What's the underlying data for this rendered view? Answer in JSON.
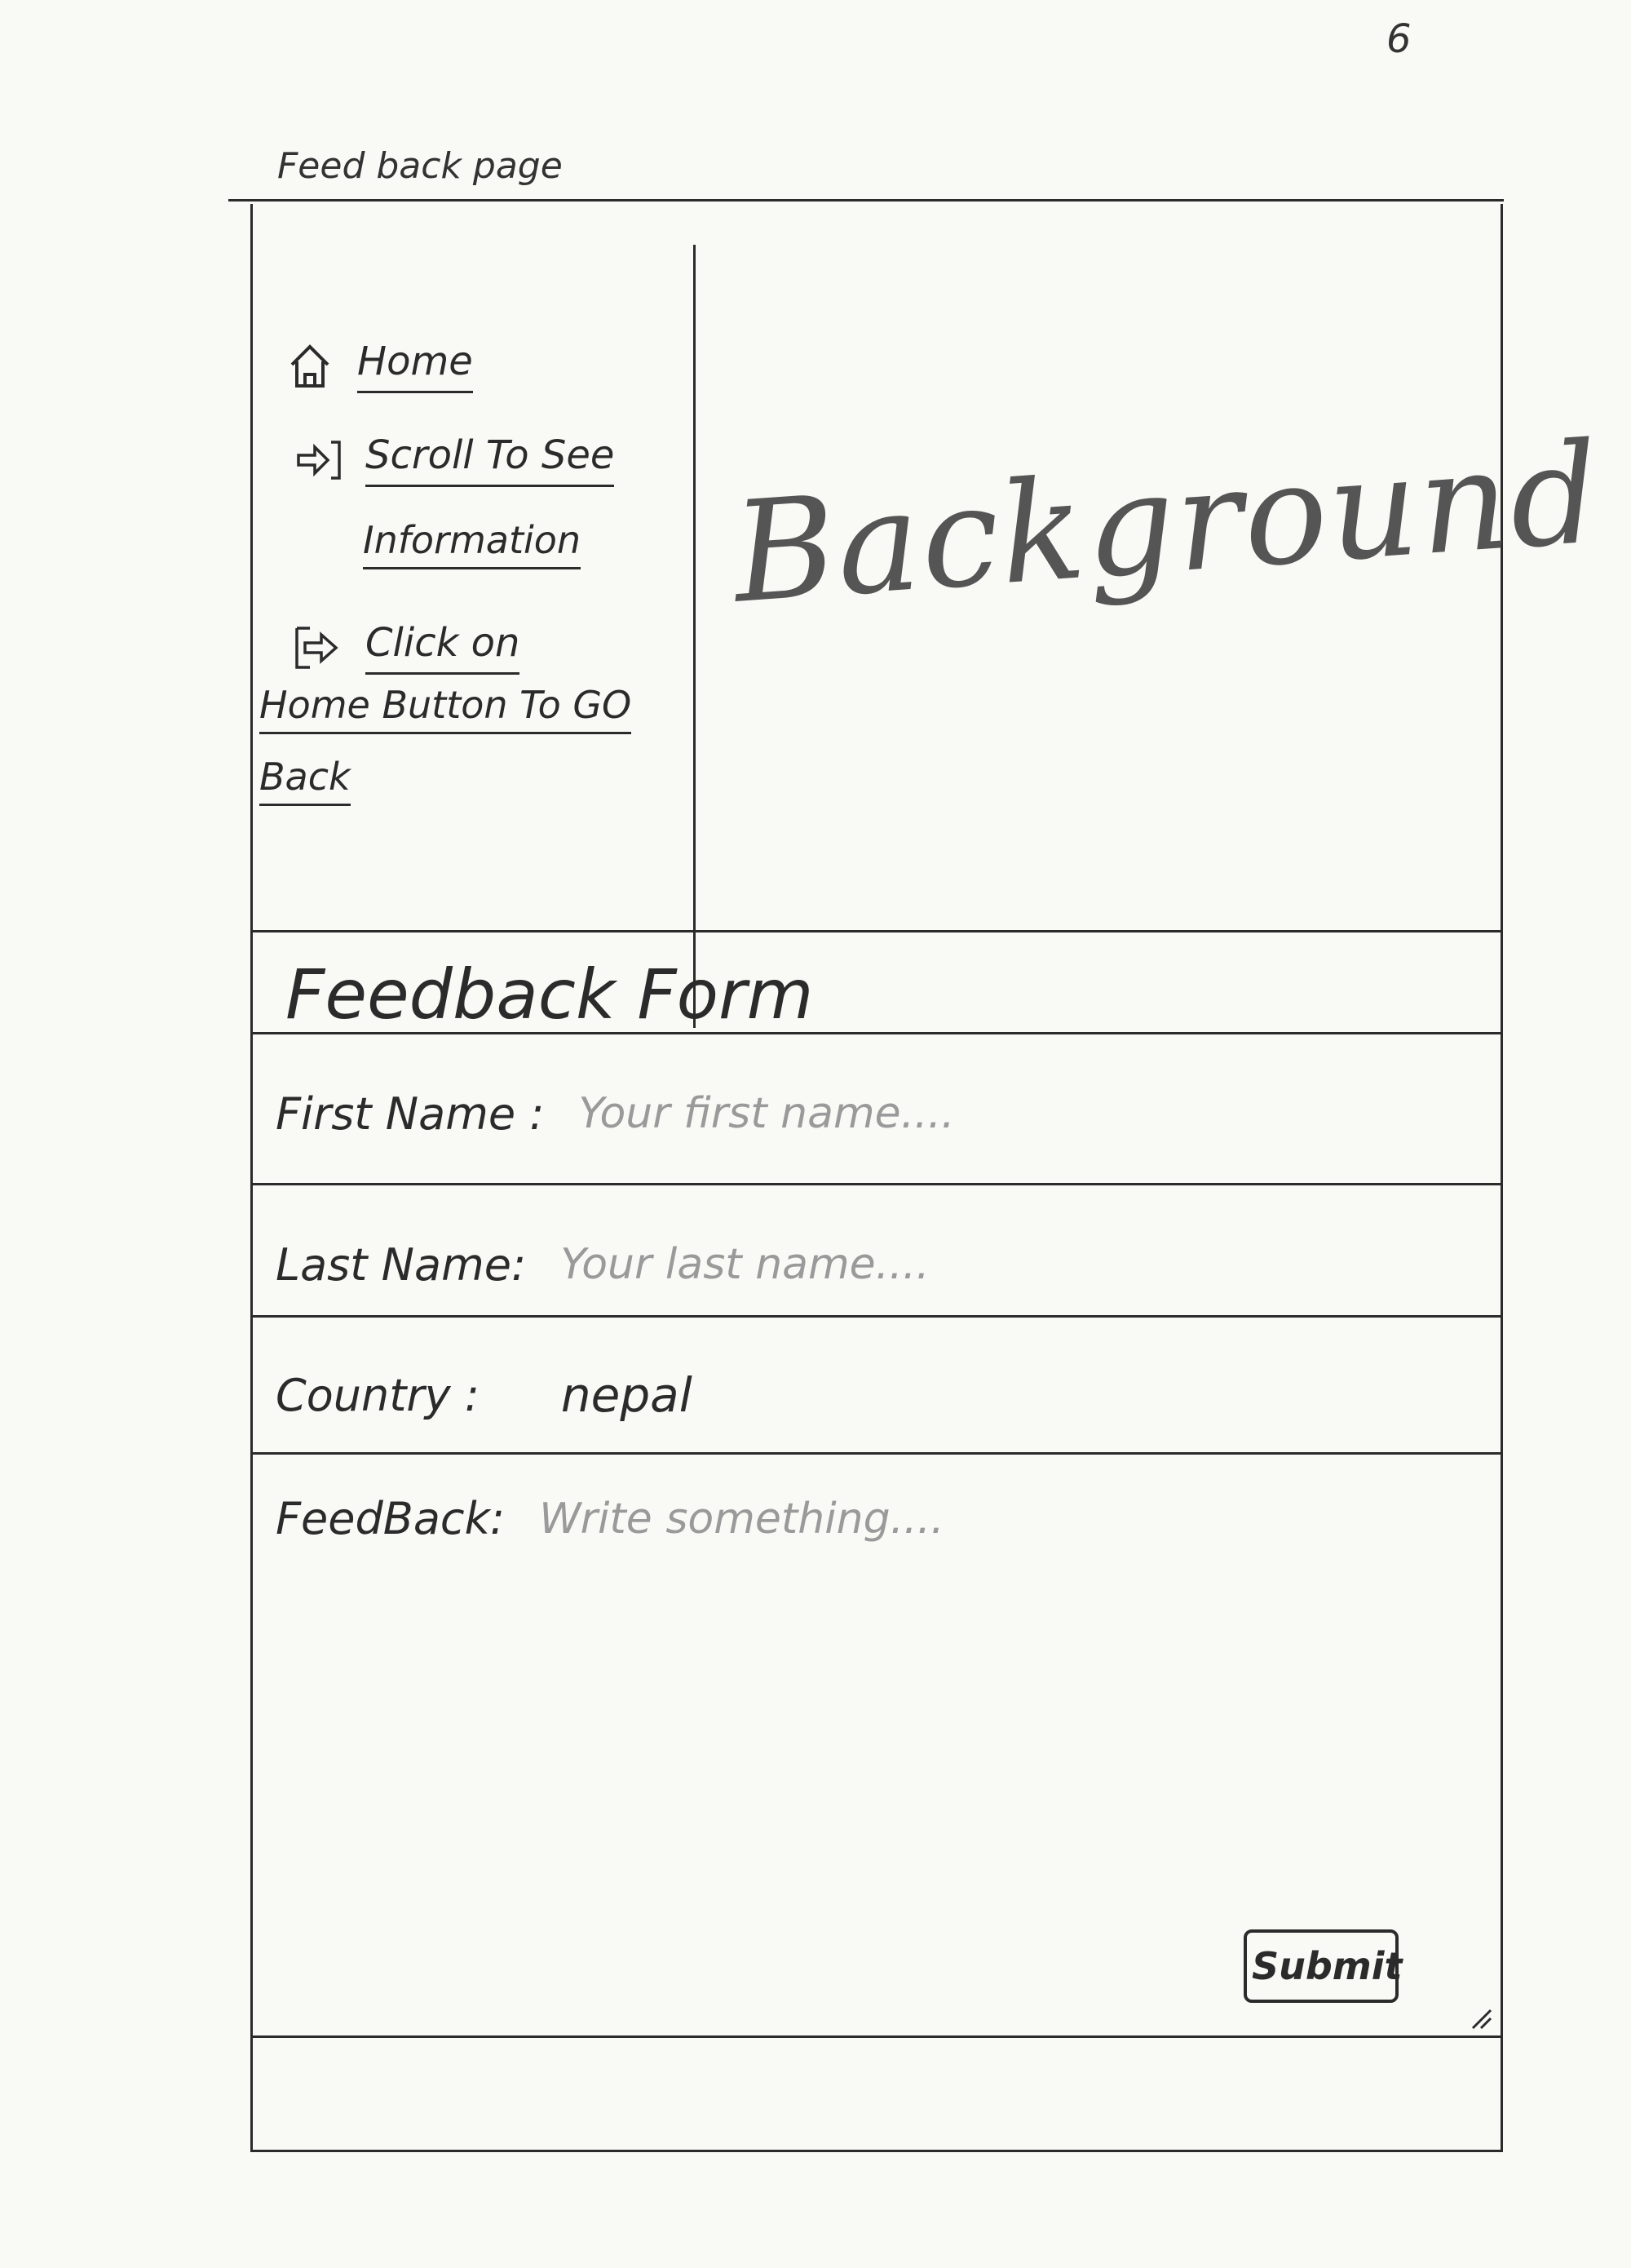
{
  "page": {
    "corner_number": "6",
    "caption": "Feed back page"
  },
  "sidebar": {
    "home_label": "Home",
    "scroll_label_line1": "Scroll To See",
    "scroll_label_line2": "Information",
    "back_label_line1": "Click on",
    "back_label_line2": "Home Button To GO",
    "back_label_line3": "Back"
  },
  "hero": {
    "text": "Background"
  },
  "form": {
    "title": "Feedback Form",
    "first_name": {
      "label": "First Name :",
      "placeholder": "Your first name...."
    },
    "last_name": {
      "label": "Last Name:",
      "placeholder": "Your last name...."
    },
    "country": {
      "label": "Country :",
      "value": "nepal"
    },
    "feedback": {
      "label": "FeedBack:",
      "placeholder": "Write something...."
    },
    "submit_label": "Submit"
  },
  "icons": {
    "home": "home-icon",
    "scroll": "arrow-right-icon",
    "back": "enter-arrow-icon",
    "grip": "resize-grip-icon"
  }
}
